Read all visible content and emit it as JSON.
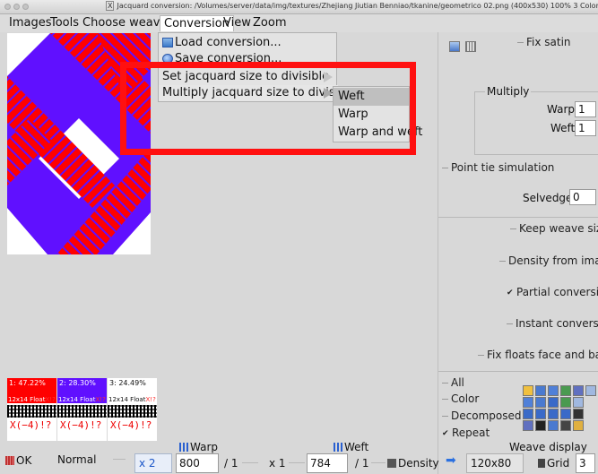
{
  "window": {
    "title": "Jacquard conversion: /Volumes/server/data/img/textures/Zhejiang Jiutian Benniao/tkanine/geometrico 02.png (400x530) 100% 3 Colors"
  },
  "menubar": {
    "items": [
      {
        "label": "Images"
      },
      {
        "label": "Tools"
      },
      {
        "label": "Choose weaves"
      },
      {
        "label": "Conversion"
      },
      {
        "label": "View"
      },
      {
        "label": "Zoom"
      }
    ]
  },
  "conversion_menu": {
    "load": "Load conversion...",
    "save": "Save conversion...",
    "set_divisible": "Set jacquard size to divisible",
    "multiply_divisible": "Multiply jacquard size to divisible"
  },
  "submenu": {
    "items": [
      "Weft",
      "Warp",
      "Warp and weft"
    ],
    "highlighted": "Weft"
  },
  "right_panel": {
    "fix_satin": "Fix satin",
    "multiply_group": "Multiply",
    "warp_label": "Warp",
    "warp_value": "1",
    "weft_label": "Weft",
    "weft_value": "1",
    "point_tie": "Point tie simulation",
    "selvedge_label": "Selvedge",
    "selvedge_value": "0",
    "keep_weave_size": "Keep weave size",
    "density_from_image": "Density from image",
    "partial_conversion": "Partial conversion",
    "partial_conversion_checked": true,
    "instant_conversion": "Instant conversion",
    "fix_floats": "Fix floats face and back",
    "all": "All",
    "color": "Color",
    "decomposed": "Decomposed",
    "repeat": "Repeat",
    "repeat_checked": true,
    "weave_display": "Weave display",
    "weave_display_value": "120x80",
    "grid_label": "Grid",
    "grid_value": "3"
  },
  "palette": [
    {
      "pct": "1: 47.22%",
      "float": "12x14 Float",
      "float_x": "X!?",
      "xval": "X(−4)!?",
      "color": "#ff0000"
    },
    {
      "pct": "2: 28.30%",
      "float": "12x14 Float",
      "float_x": "X!?",
      "xval": "X(−4)!?",
      "color": "#6010ff"
    },
    {
      "pct": "3: 24.49%",
      "float": "12x14 Float",
      "float_x": "X!?",
      "xval": "X(−4)!?",
      "color": "#ffffff"
    }
  ],
  "bottom": {
    "ok": "OK",
    "mode": "Normal",
    "warp_header": "Warp",
    "warp_mult": "x 2",
    "warp_value": "800",
    "warp_div": "/ 1",
    "weft_header": "Weft",
    "weft_mult": "x 1",
    "weft_value": "784",
    "weft_div": "/ 1",
    "density": "Density"
  },
  "colors": {
    "red": "#ff0000",
    "purple": "#6010ff",
    "white": "#ffffff",
    "highlight_frame": "#ff1010"
  }
}
